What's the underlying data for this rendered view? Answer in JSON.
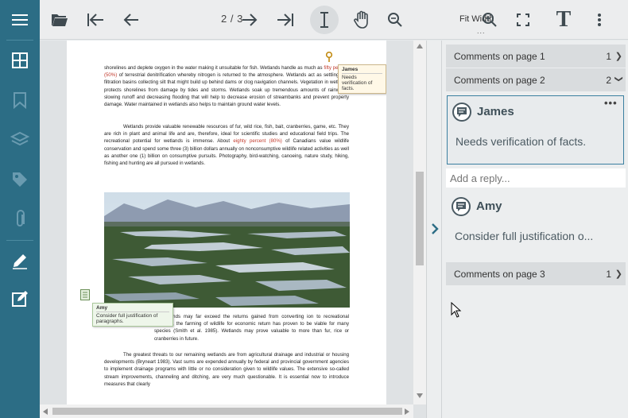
{
  "sidebar": {
    "icons": [
      "menu-icon",
      "thumbnails-icon",
      "bookmark-icon",
      "layers-icon",
      "tag-icon",
      "attachment-icon",
      "annotate-icon",
      "edit-icon"
    ]
  },
  "toolbar": {
    "page_indicator": "2 / 3",
    "fit_label": "Fit Width",
    "fit_dots": "...",
    "text_tool_label": "T"
  },
  "document": {
    "para1": "shorelines and deplete oxygen in the water making it unsuitable for fish. Wetlands handle as much as fifty percent (50%) of terrestrial denitrification whereby nitrogen is returned to the atmosphere. Wetlands act as settling and filtration basins collecting silt that might build up behind dams or clog navigation channels. Vegetation in wetlands protects shorelines from damage by tides and storms. Wetlands soak up tremendous amounts of rainwater, slowing runoff and decreasing flooding that will help to decrease erosion of streambanks and prevent property damage. Water maintained in wetlands also helps to maintain ground water levels.",
    "para2": "Wetlands provide valuable renewable resources of fur, wild rice, fish, bait, cranberries, game, etc. They are rich in plant and animal life and are, therefore, ideal for scientific studies and educational field trips. The recreational potential for wetlands is immense. About eighty percent (80%) of Canadians value wildlife conservation and spend some three (3) billion dollars annually on nonconsumptive wildlife related activities as well as another one (1) billion on consumptive pursuits. Photography, bird-watching, canoeing, nature study, hiking, fishing and hunting are all pursued in wetlands.",
    "para3": "of wetlands may far exceed the returns gained from converting ion to recreational potential, the farming of wildlife for economic return has proven to be viable for many species (Smith et al. 1985). Wetlands may prove valuable to more than fur, rice or cranberries in future.",
    "para4": "The greatest threats to our remaining wetlands are from agricultural drainage and industrial or housing developments (Bryneart 1983). Vast sums are expended annually by federal and provincial government agencies to implement drainage programs with little or no consideration given to wildlife values. The extensive so-called stream improvements, channeling and ditching, are very much questionable. It is essential now to introduce measures that clearly",
    "note_james_author": "James",
    "note_james_text": "Needs verification of facts.",
    "note_amy_author": "Amy",
    "note_amy_text": "Consider full justification of paragraphs."
  },
  "comments": {
    "page1_label": "Comments on page 1",
    "page1_count": "1",
    "page2_label": "Comments on page 2",
    "page2_count": "2",
    "page3_label": "Comments on page 3",
    "page3_count": "1",
    "c1_author": "James",
    "c1_text": "Needs verification of facts.",
    "c1_more": "•••",
    "reply_placeholder": "Add a reply...",
    "c2_author": "Amy",
    "c2_text": "Consider full justification o..."
  },
  "colors": {
    "sidebar": "#2c6d85",
    "accent": "#3a7fa0",
    "highlight_red": "#c0392b"
  }
}
